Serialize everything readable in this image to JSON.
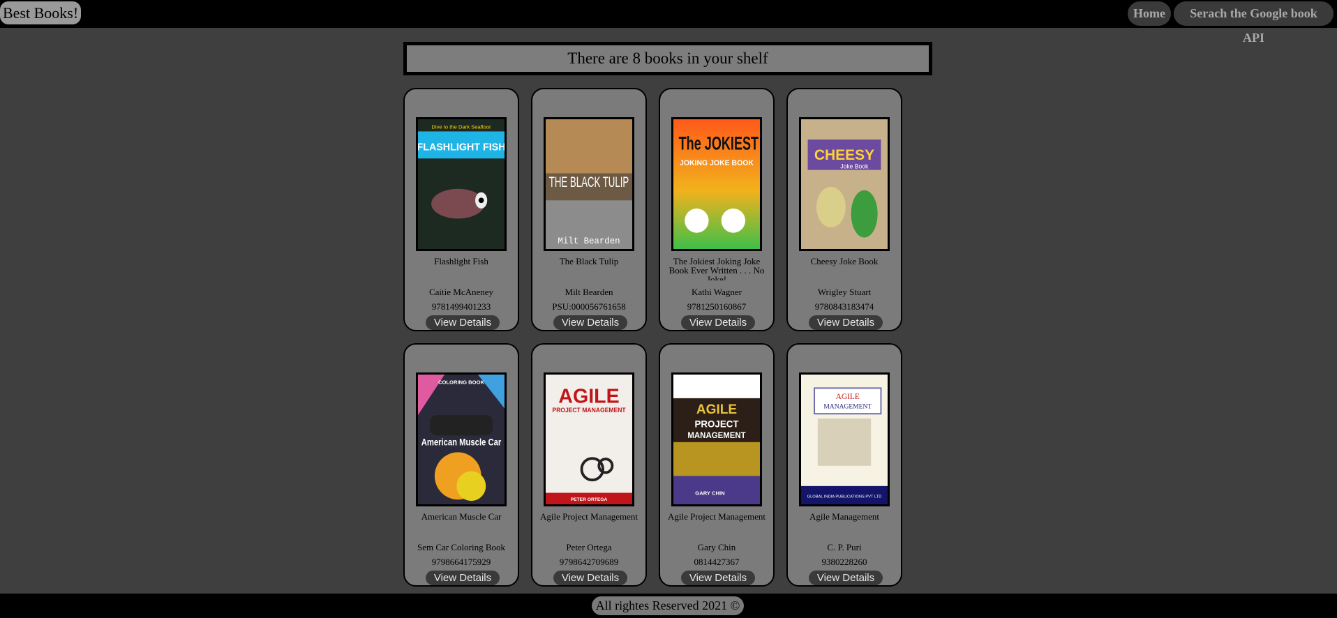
{
  "header": {
    "brand": "Best Books!",
    "nav": {
      "home": "Home",
      "search_api": "Serach the Google book API"
    }
  },
  "shelf": {
    "count_text": "There are 8 books in your shelf"
  },
  "books": [
    {
      "title": "Flashlight Fish",
      "author": "Caitie McAneney",
      "isbn": "9781499401233",
      "button": "View Details",
      "cover": {
        "text": "FLASHLIGHT FISH",
        "top": "Dive to the Dark Seafloor"
      }
    },
    {
      "title": "The Black Tulip",
      "author": "Milt Bearden",
      "isbn": "PSU:000056761658",
      "button": "View Details",
      "cover": {
        "text": "THE BLACK TULIP",
        "bottom": "Milt Bearden"
      }
    },
    {
      "title": "The Jokiest Joking Joke Book Ever Written . . . No Joke!",
      "author": "Kathi Wagner",
      "isbn": "9781250160867",
      "button": "View Details",
      "cover": {
        "text": "The JOKIEST",
        "sub": "JOKING JOKE BOOK"
      }
    },
    {
      "title": "Cheesy Joke Book",
      "author": "Wrigley Stuart",
      "isbn": "9780843183474",
      "button": "View Details",
      "cover": {
        "text": "CHEESY",
        "sub": "Joke Book"
      }
    },
    {
      "title": "American Muscle Car",
      "author": "Sem Car Coloring Book",
      "isbn": "9798664175929",
      "button": "View Details",
      "cover": {
        "text": "American Muscle Car",
        "top": "COLORING BOOK"
      }
    },
    {
      "title": "Agile Project Management",
      "author": "Peter Ortega",
      "isbn": "9798642709689",
      "button": "View Details",
      "cover": {
        "text": "AGILE",
        "sub": "PROJECT MANAGEMENT",
        "bottom": "PETER ORTEGA"
      }
    },
    {
      "title": "Agile Project Management",
      "author": "Gary Chin",
      "isbn": "0814427367",
      "button": "View Details",
      "cover": {
        "text": "AGILE",
        "sub": "PROJECT",
        "sub2": "MANAGEMENT",
        "bottom": "GARY CHIN"
      }
    },
    {
      "title": "Agile Management",
      "author": "C. P. Puri",
      "isbn": "9380228260",
      "button": "View Details",
      "cover": {
        "text": "AGILE",
        "sub": "MANAGEMENT",
        "bottom": "GLOBAL INDIA PUBLICATIONS PVT LTD"
      }
    }
  ],
  "footer": {
    "text": "All rightes Reserved 2021 ©"
  }
}
